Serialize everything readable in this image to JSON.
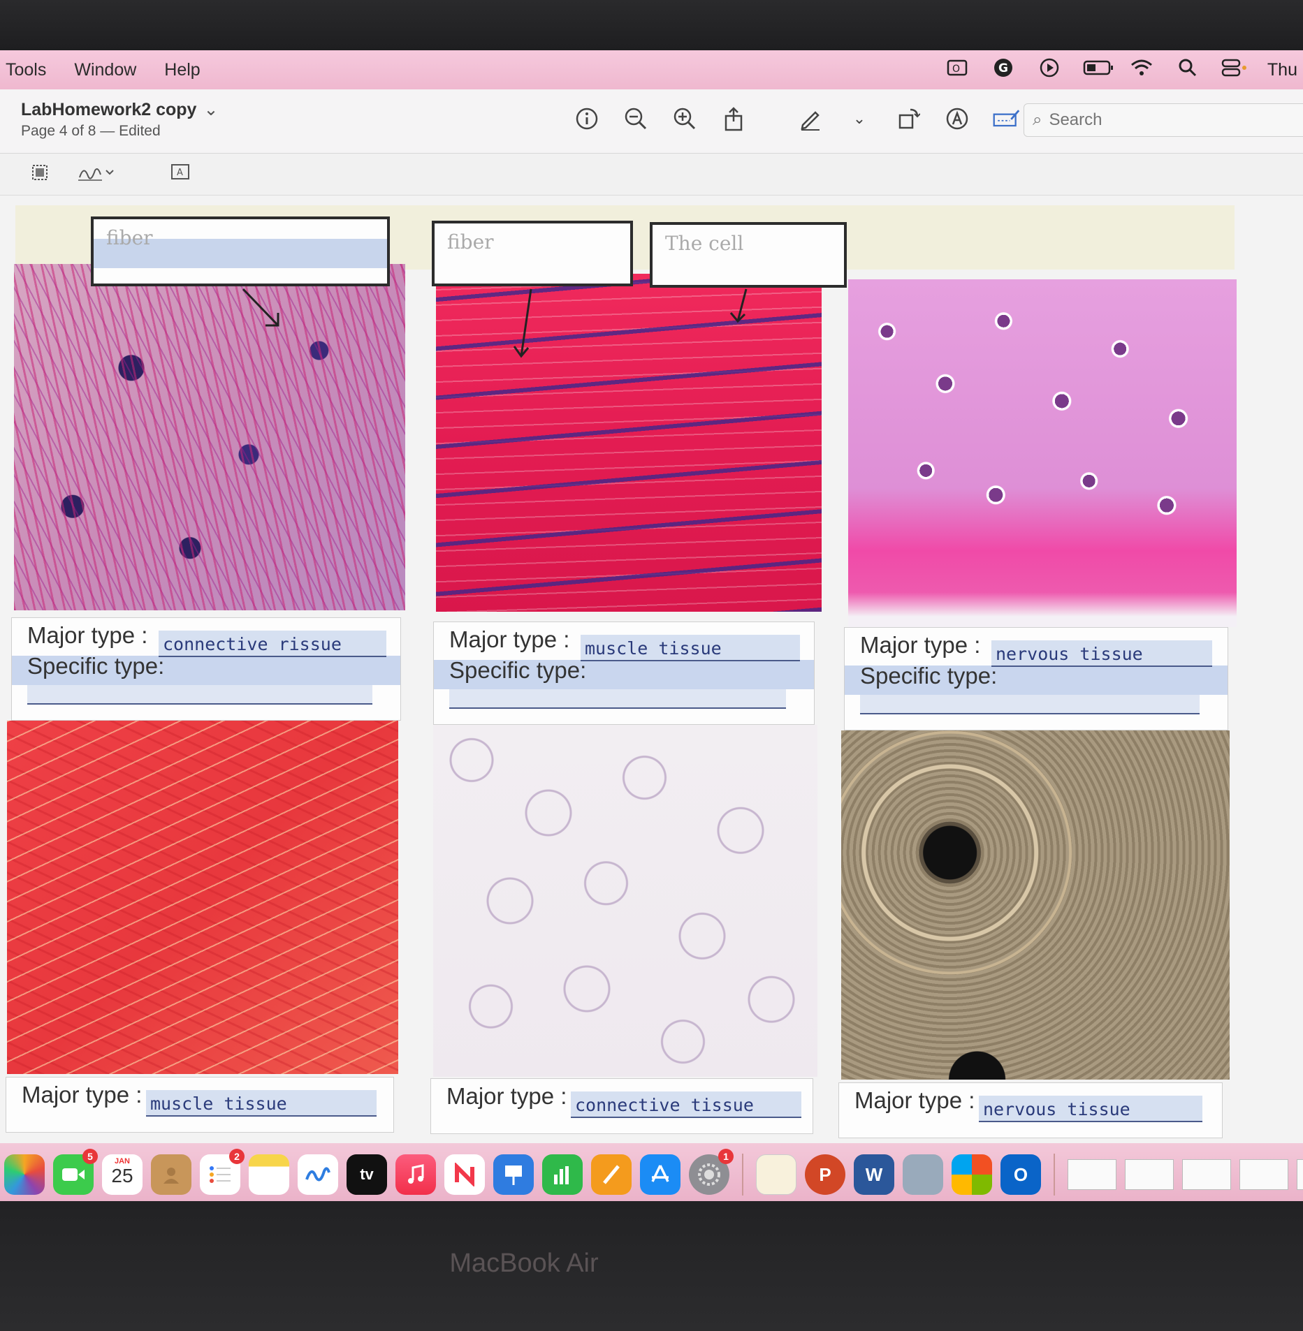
{
  "menubar": {
    "items": [
      "Tools",
      "Window",
      "Help"
    ],
    "clock": "Thu"
  },
  "toolbar": {
    "title": "LabHomework2 copy",
    "subtitle": "Page 4 of 8 — Edited",
    "search_placeholder": "Search"
  },
  "labels": {
    "box1": "fiber",
    "box2": "fiber",
    "box3": "The cell"
  },
  "captions": {
    "major_label": "Major type :",
    "specific_label": "Specific type:",
    "cells": [
      {
        "major": "connective rissue"
      },
      {
        "major": "muscle tissue"
      },
      {
        "major": "nervous tissue"
      },
      {
        "major": "muscle tissue"
      },
      {
        "major": "connective tissue"
      },
      {
        "major": "nervous tissue"
      }
    ]
  },
  "dock": {
    "calendar_month": "JAN",
    "calendar_day": "25",
    "facetime_badge": "5",
    "reminders_badge": "2",
    "settings_badge": "1",
    "tv_label": "tv"
  },
  "brand": "MacBook Air"
}
